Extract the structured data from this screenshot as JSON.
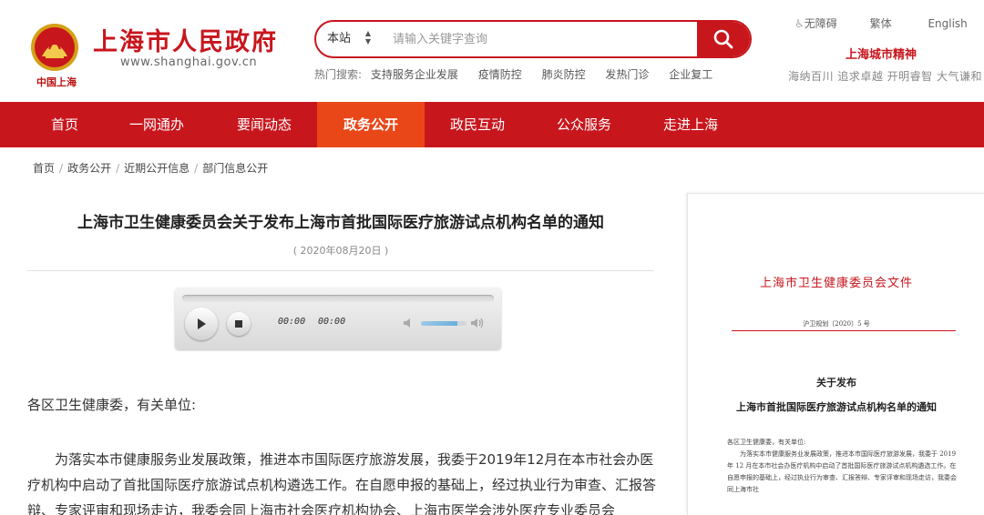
{
  "header": {
    "site_title": "上海市人民政府",
    "site_url": "www.shanghai.gov.cn",
    "logo_caption": "中国上海",
    "brand_color": "#c8161d"
  },
  "search": {
    "scope": "本站",
    "placeholder": "请输入关键字查询",
    "hot_label": "热门搜索:",
    "hot_items": [
      "支持服务企业发展",
      "疫情防控",
      "肺炎防控",
      "发热门诊",
      "企业复工"
    ]
  },
  "utilities": {
    "accessibility": "无障碍",
    "traditional": "繁体",
    "english": "English"
  },
  "city_spirit": {
    "title": "上海城市精神",
    "text": "海纳百川 追求卓越 开明睿智 大气谦和"
  },
  "nav": {
    "items": [
      "首页",
      "一网通办",
      "要闻动态",
      "政务公开",
      "政民互动",
      "公众服务",
      "走进上海"
    ],
    "active_index": 3,
    "active_color": "#e94718"
  },
  "breadcrumb": [
    "首页",
    "政务公开",
    "近期公开信息",
    "部门信息公开"
  ],
  "article": {
    "title": "上海市卫生健康委员会关于发布上海市首批国际医疗旅游试点机构名单的通知",
    "date": "( 2020年08月20日 )",
    "greeting": "各区卫生健康委，有关单位:",
    "paragraph": "为落实本市健康服务业发展政策，推进本市国际医疗旅游发展，我委于2019年12月在本市社会办医疗机构中启动了首批国际医疗旅游试点机构遴选工作。在自愿申报的基础上，经过执业行为审查、汇报答辩、专家评审和现场走访，我委会同上海市社会医疗机构协会、上海市医学会涉外医疗专业委员会"
  },
  "player": {
    "current_time": "00:00",
    "duration": "00:00",
    "volume": 0.8
  },
  "document": {
    "header": "上海市卫生健康委员会文件",
    "number": "沪卫规划〔2020〕5 号",
    "title_line1": "关于发布",
    "title_line2": "上海市首批国际医疗旅游试点机构名单的通知",
    "greeting": "各区卫生健康委，有关单位:",
    "body": "为落实本市健康服务业发展政策，推进本市国际医疗旅游发展，我委于 2019 年 12 月在本市社会办医疗机构中启动了首批国际医疗旅游试点机构遴选工作。在自愿申报的基础上，经过执业行为审查、汇报答辩、专家评审和现场走访，我委会同上海市社"
  }
}
